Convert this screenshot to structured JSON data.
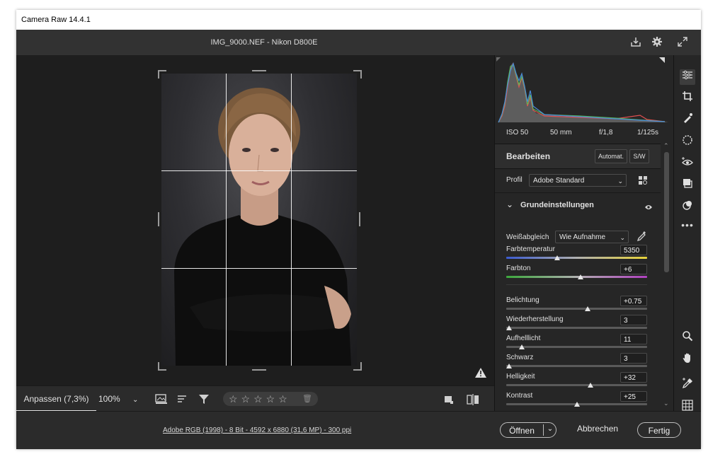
{
  "window": {
    "title": "Camera Raw 14.4.1",
    "filename": "IMG_9000.NEF - Nikon D800E"
  },
  "top_icons": [
    "save-icon",
    "gear-icon",
    "fullscreen-icon"
  ],
  "histogram": {
    "exif": {
      "iso": "ISO 50",
      "focal": "50 mm",
      "aperture": "f/1,8",
      "shutter": "1/125s"
    }
  },
  "edit": {
    "title": "Bearbeiten",
    "auto_label": "Automat.",
    "bw_label": "S/W",
    "profile_label": "Profil",
    "profile_value": "Adobe Standard"
  },
  "basic": {
    "title": "Grundeinstellungen",
    "wb_label": "Weißabgleich",
    "wb_value": "Wie Aufnahme",
    "sliders": [
      {
        "label": "Farbtemperatur",
        "value": "5350",
        "position": 0.36
      },
      {
        "label": "Farbton",
        "value": "+6",
        "position": 0.53
      },
      {
        "label": "Belichtung",
        "value": "+0.75",
        "position": 0.58
      },
      {
        "label": "Wiederherstellung",
        "value": "3",
        "position": 0.02
      },
      {
        "label": "Aufhelllicht",
        "value": "11",
        "position": 0.11
      },
      {
        "label": "Schwarz",
        "value": "3",
        "position": 0.02
      },
      {
        "label": "Helligkeit",
        "value": "+32",
        "position": 0.6
      },
      {
        "label": "Kontrast",
        "value": "+25",
        "position": 0.5
      }
    ]
  },
  "bottom": {
    "zoom_fit": "Anpassen (7,3%)",
    "zoom_pct": "100%",
    "rating_stars": "☆☆☆☆☆"
  },
  "footer": {
    "info": "Adobe RGB (1998) - 8 Bit - 4592 x 6880 (31,6 MP) - 300 ppi",
    "open_label": "Öffnen",
    "cancel_label": "Abbrechen",
    "done_label": "Fertig"
  },
  "colors": {
    "background": "#1e1e1e",
    "panel": "#262626",
    "accent": "#e6e6e6"
  }
}
